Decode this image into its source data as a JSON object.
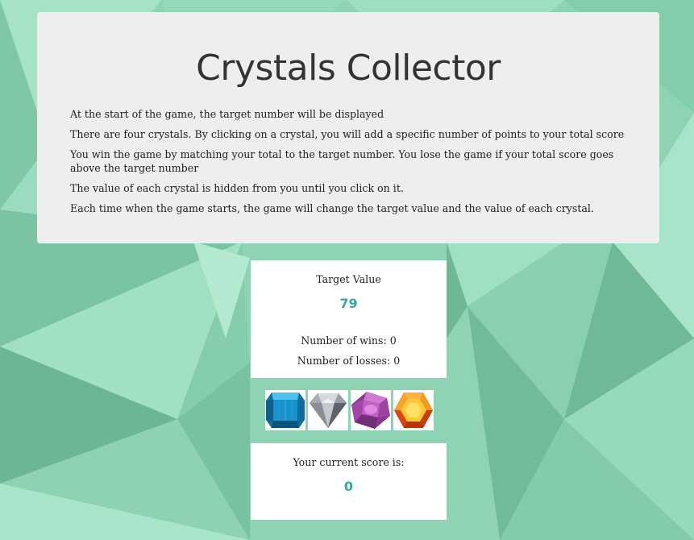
{
  "title": "Crystals Collector",
  "rules": [
    "At the start of the game, the target number will be displayed",
    "There are four crystals. By clicking on a crystal, you will add a specific number of points to your total score",
    "You win the game by matching your total to the target number. You lose the game if your total score goes above the target number",
    "The value of each crystal is hidden from you until you click on it.",
    "Each time when the game starts, the game will change the target value and the value of each crystal."
  ],
  "target": {
    "label": "Target Value",
    "value": "79",
    "wins_text": "Number of wins: 0",
    "losses_text": "Number of losses: 0"
  },
  "crystals": [
    {
      "icon": "blue-crystal-icon",
      "color": "#1a8fc4"
    },
    {
      "icon": "silver-diamond-icon",
      "color": "#8a8f98"
    },
    {
      "icon": "purple-gem-icon",
      "color": "#b14fb6"
    },
    {
      "icon": "orange-gem-icon",
      "color": "#f28a1a"
    }
  ],
  "score": {
    "label": "Your current score is:",
    "value": "0"
  },
  "colors": {
    "accent": "#3aa896",
    "background": "#8fd4b5",
    "panel": "#eeeeee"
  }
}
